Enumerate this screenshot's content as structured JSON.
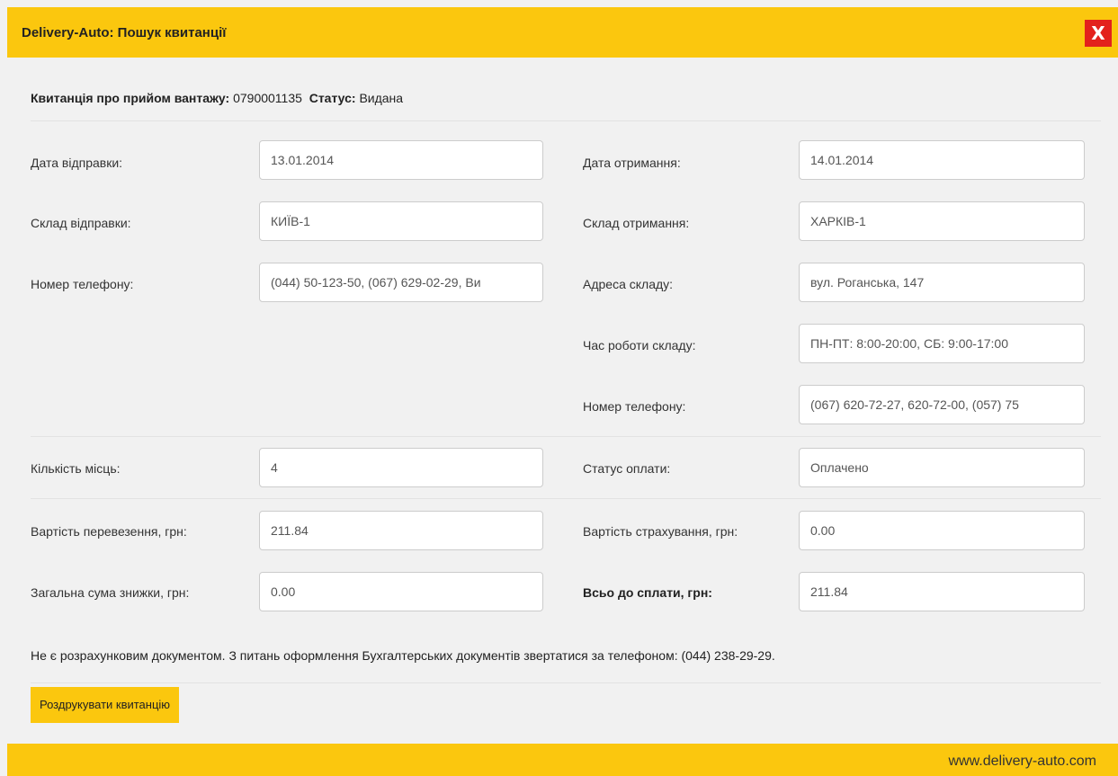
{
  "window": {
    "title": "Delivery-Auto: Пошук квитанції",
    "close_label": "X"
  },
  "receipt": {
    "number_label": "Квитанція про прийом вантажу:",
    "number_value": "0790001135",
    "status_label": "Статус:",
    "status_value": "Видана"
  },
  "left": {
    "send_date_label": "Дата відправки:",
    "send_date_value": "13.01.2014",
    "send_warehouse_label": "Склад відправки:",
    "send_warehouse_value": "КИЇВ-1",
    "phone_label": "Номер телефону:",
    "phone_value": "(044) 50-123-50, (067) 629-02-29, Ви"
  },
  "right": {
    "receive_date_label": "Дата отримання:",
    "receive_date_value": "14.01.2014",
    "receive_warehouse_label": "Склад отримання:",
    "receive_warehouse_value": "ХАРКІВ-1",
    "address_label": "Адреса складу:",
    "address_value": "вул. Роганська, 147",
    "hours_label": "Час роботи складу:",
    "hours_value": "ПН-ПТ: 8:00-20:00, СБ: 9:00-17:00",
    "phone_label": "Номер телефону:",
    "phone_value": "(067) 620-72-27, 620-72-00, (057) 75"
  },
  "cargo": {
    "places_label": "Кількість місць:",
    "places_value": "4",
    "payment_status_label": "Статус оплати:",
    "payment_status_value": "Оплачено"
  },
  "costs": {
    "transport_label": "Вартість перевезення, грн:",
    "transport_value": "211.84",
    "insurance_label": "Вартість страхування, грн:",
    "insurance_value": "0.00",
    "discount_label": "Загальна сума знижки, грн:",
    "discount_value": "0.00",
    "total_label": "Всьо до сплати, грн:",
    "total_value": "211.84"
  },
  "note": "Не є розрахунковим документом. З питань оформлення Бухгалтерських документів звертатися за телефоном: (044) 238-29-29.",
  "print_button": "Роздрукувати квитанцію",
  "footer": {
    "site": "www.delivery-auto.com"
  },
  "colors": {
    "accent": "#fbc70e",
    "close": "#e3211c",
    "background": "#f1f1f1"
  }
}
